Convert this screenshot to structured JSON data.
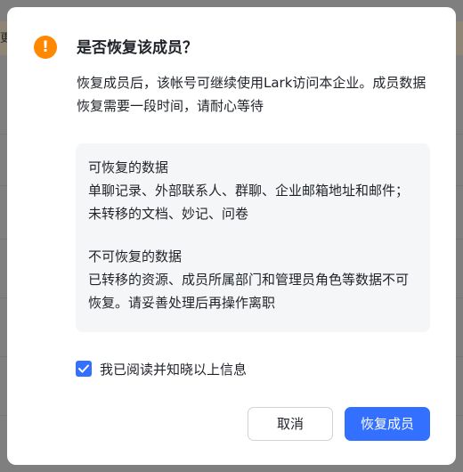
{
  "dialog": {
    "title": "是否恢复该成员？",
    "description": "恢复成员后，该帐号可继续使用Lark访问本企业。成员数据恢复需要一段时间，请耐心等待",
    "recoverable": {
      "heading": "可恢复的数据",
      "body": "单聊记录、外部联系人、群聊、企业邮箱地址和邮件；未转移的文档、妙记、问卷"
    },
    "unrecoverable": {
      "heading": "不可恢复的数据",
      "body": "已转移的资源、成员所属部门和管理员角色等数据不可恢复。请妥善处理后再操作离职"
    },
    "acknowledge": {
      "label": "我已阅读并知晓以上信息",
      "checked": true
    },
    "cancel_label": "取消",
    "confirm_label": "恢复成员"
  },
  "background": {
    "visible_text": "更"
  },
  "colors": {
    "primary": "#3370ff",
    "warning": "#ff8800",
    "info_bg": "#f5f6f7"
  },
  "icons": {
    "warning": "exclamation-circle-icon",
    "check": "checkmark-icon"
  }
}
